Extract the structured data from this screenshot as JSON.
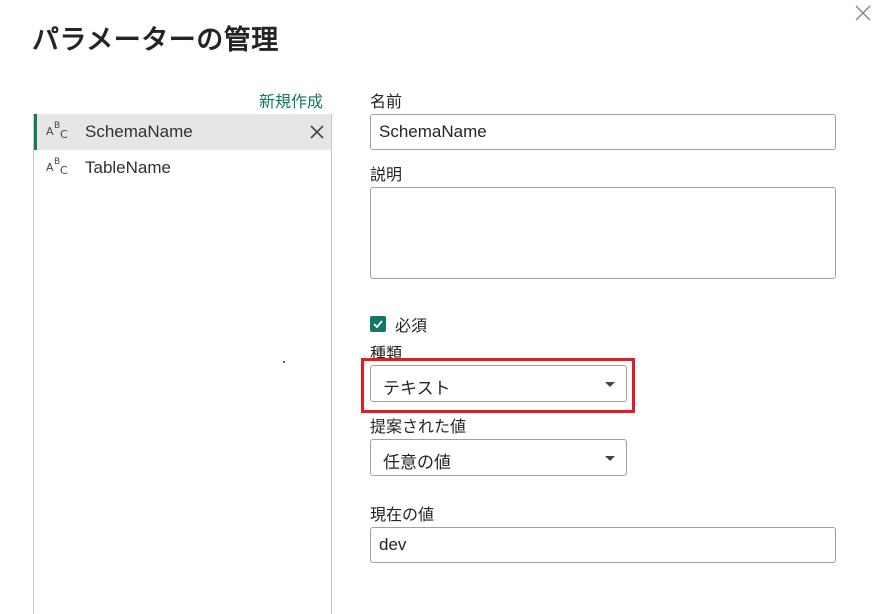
{
  "dialog": {
    "title": "パラメーターの管理",
    "close_icon": "close-icon"
  },
  "list": {
    "new_label": "新規作成",
    "items": [
      {
        "label": "SchemaName",
        "icon": "text-type-icon",
        "selected": true
      },
      {
        "label": "TableName",
        "icon": "text-type-icon",
        "selected": false
      }
    ]
  },
  "form": {
    "name_label": "名前",
    "name_value": "SchemaName",
    "description_label": "説明",
    "description_value": "",
    "required_label": "必須",
    "required_checked": true,
    "type_label": "種類",
    "type_value": "テキスト",
    "suggested_label": "提案された値",
    "suggested_value": "任意の値",
    "current_label": "現在の値",
    "current_value": "dev"
  },
  "colors": {
    "accent": "#117865",
    "highlight": "#e31b23",
    "selected_bg": "#e7e6e6",
    "border": "#a19f9d"
  }
}
